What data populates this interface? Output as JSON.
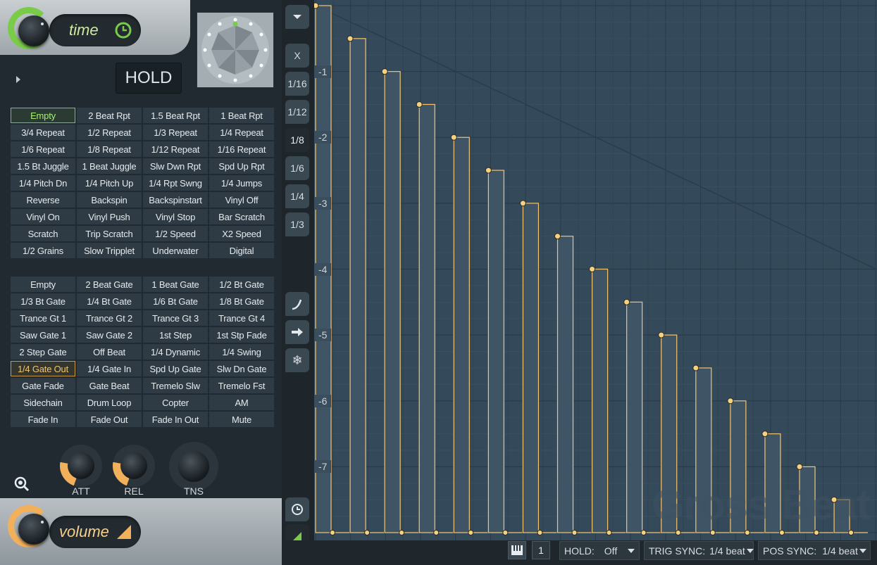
{
  "top_mode": {
    "label": "time",
    "icon": "clock-icon"
  },
  "hold_button": "HOLD",
  "presets_time": [
    "Empty",
    "2 Beat Rpt",
    "1.5 Beat Rpt",
    "1 Beat Rpt",
    "3/4 Repeat",
    "1/2 Repeat",
    "1/3 Repeat",
    "1/4 Repeat",
    "1/6 Repeat",
    "1/8 Repeat",
    "1/12 Repeat",
    "1/16 Repeat",
    "1.5 Bt Juggle",
    "1 Beat Juggle",
    "Slw Dwn Rpt",
    "Spd Up Rpt",
    "1/4 Pitch Dn",
    "1/4 Pitch Up",
    "1/4 Rpt Swng",
    "1/4 Jumps",
    "Reverse",
    "Backspin",
    "Backspinstart",
    "Vinyl Off",
    "Vinyl On",
    "Vinyl Push",
    "Vinyl Stop",
    "Bar Scratch",
    "Scratch",
    "Trip Scratch",
    "1/2 Speed",
    "X2 Speed",
    "1/2 Grains",
    "Slow Tripplet",
    "Underwater",
    "Digital"
  ],
  "presets_volume": [
    "Empty",
    "2 Beat Gate",
    "1 Beat Gate",
    "1/2 Bt Gate",
    "1/3 Bt Gate",
    "1/4 Bt Gate",
    "1/6 Bt Gate",
    "1/8 Bt Gate",
    "Trance Gt 1",
    "Trance Gt 2",
    "Trance Gt 3",
    "Trance Gt 4",
    "Saw Gate 1",
    "Saw Gate 2",
    "1st Step",
    "1st Stp Fade",
    "2 Step Gate",
    "Off Beat",
    "1/4 Dynamic",
    "1/4 Swing",
    "1/4 Gate Out",
    "1/4 Gate In",
    "Spd Up Gate",
    "Slw Dn Gate",
    "Gate Fade",
    "Gate Beat",
    "Tremelo Slw",
    "Tremelo Fst",
    "Sidechain",
    "Drum Loop",
    "Copter",
    "AM",
    "Fade In",
    "Fade Out",
    "Fade In Out",
    "Mute"
  ],
  "selected_time_preset": "Empty",
  "selected_volume_preset": "1/4 Gate Out",
  "knobs": [
    {
      "label": "ATT",
      "value": 0.3
    },
    {
      "label": "REL",
      "value": 0.3
    },
    {
      "label": "TNS",
      "value": 0.5
    }
  ],
  "bottom_mode": {
    "label": "volume"
  },
  "side_buttons": [
    "X",
    "1/16",
    "1/12",
    "1/8",
    "1/6",
    "1/4",
    "1/3"
  ],
  "active_division": "1/8",
  "toolbar": {
    "hold_label": "HOLD:",
    "hold_value": "Off",
    "trig_label": "TRIG SYNC:",
    "trig_value": "1/4 beat",
    "pos_label": "POS SYNC:",
    "pos_value": "1/4 beat",
    "step_button": "1"
  },
  "watermark": "Gross Beat",
  "colors": {
    "accent_green": "#7acb48",
    "envelope": "#f3c46f",
    "plot_bg": "#34495a"
  },
  "chart_data": {
    "type": "line",
    "y_ticks": [
      "-1",
      "-2",
      "-3",
      "-4",
      "-5",
      "-6",
      "-7"
    ],
    "ylim": [
      -8,
      0
    ],
    "x_steps": 16,
    "values": [
      0,
      -0.5,
      -1,
      -1.5,
      -2,
      -2.5,
      -3,
      -3.5,
      -4,
      -4.5,
      -5,
      -5.5,
      -6,
      -6.5,
      -7,
      -7.5
    ]
  }
}
